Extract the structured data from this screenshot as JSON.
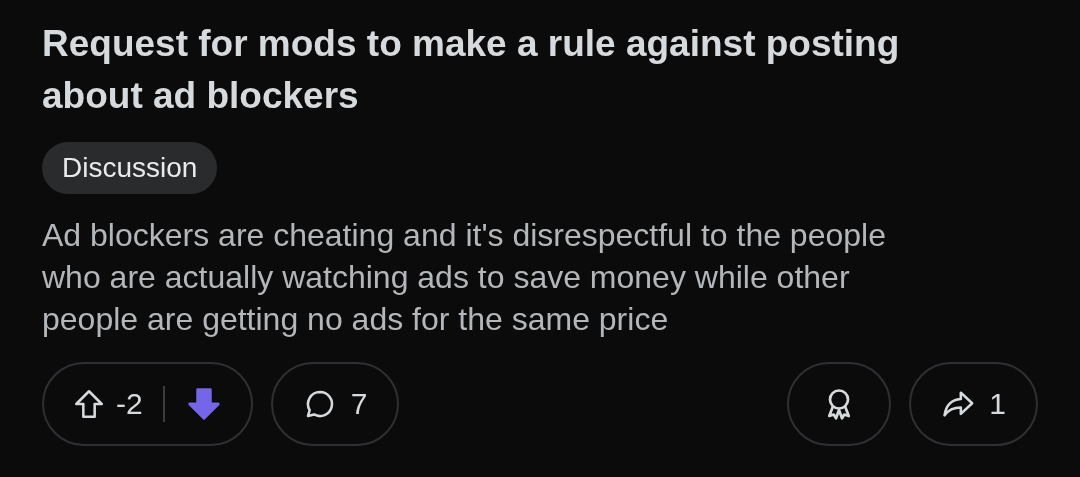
{
  "post": {
    "title": "Request for mods to make a rule against posting about ad blockers",
    "flair": "Discussion",
    "body": "Ad blockers are cheating and it's disrespectful to the people who are actually watching ads to save money while other people are getting no ads for the same price"
  },
  "vote": {
    "score": "-2",
    "upvoted": false,
    "downvoted": true
  },
  "comments": {
    "count": "7"
  },
  "share": {
    "count": "1"
  }
}
